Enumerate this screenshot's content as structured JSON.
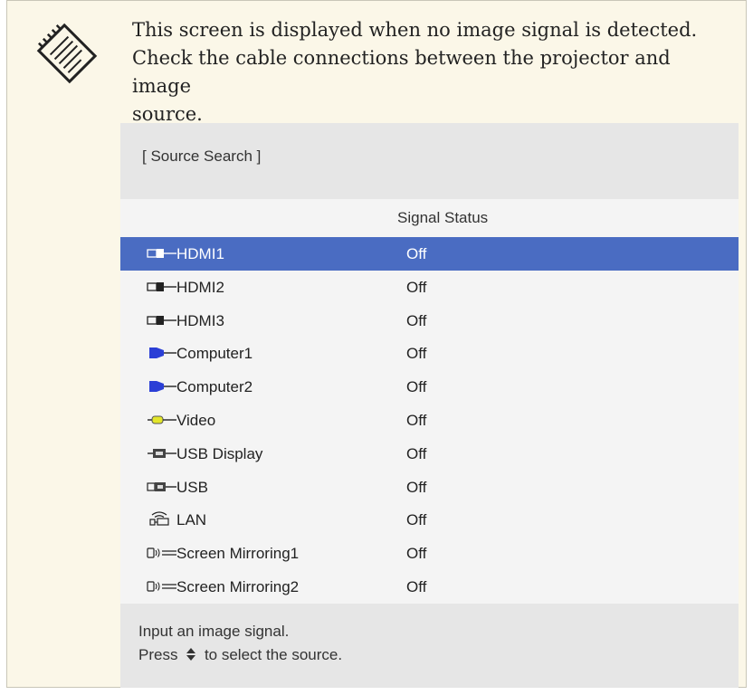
{
  "note": {
    "line1": "This screen is displayed when no image signal is detected.",
    "line2": "Check the cable connections between the projector and image",
    "line3": "source."
  },
  "osd": {
    "title": "[ Source Search ]",
    "column_header": "Signal Status",
    "sources": [
      {
        "name": "HDMI1",
        "status": "Off",
        "icon": "hdmi-icon",
        "selected": true
      },
      {
        "name": "HDMI2",
        "status": "Off",
        "icon": "hdmi-icon",
        "selected": false
      },
      {
        "name": "HDMI3",
        "status": "Off",
        "icon": "hdmi-icon",
        "selected": false
      },
      {
        "name": "Computer1",
        "status": "Off",
        "icon": "vga-computer-icon",
        "selected": false
      },
      {
        "name": "Computer2",
        "status": "Off",
        "icon": "vga-computer-icon",
        "selected": false
      },
      {
        "name": "Video",
        "status": "Off",
        "icon": "video-rca-icon",
        "selected": false
      },
      {
        "name": "USB Display",
        "status": "Off",
        "icon": "usb-display-icon",
        "selected": false
      },
      {
        "name": "USB",
        "status": "Off",
        "icon": "usb-icon",
        "selected": false
      },
      {
        "name": "LAN",
        "status": "Off",
        "icon": "lan-icon",
        "selected": false
      },
      {
        "name": "Screen Mirroring1",
        "status": "Off",
        "icon": "screen-mirroring-icon",
        "selected": false
      },
      {
        "name": "Screen Mirroring2",
        "status": "Off",
        "icon": "screen-mirroring-icon",
        "selected": false
      }
    ],
    "footer": {
      "line1": "Input an image signal.",
      "line2_prefix": "Press",
      "line2_icon": "up-down-arrows-icon",
      "line2_suffix": "to select the source."
    }
  },
  "colors": {
    "note_background": "#fbf7e8",
    "selected_row": "#4a6cc2",
    "vga_blue": "#2b3fd6",
    "video_yellow": "#e3e62a"
  }
}
